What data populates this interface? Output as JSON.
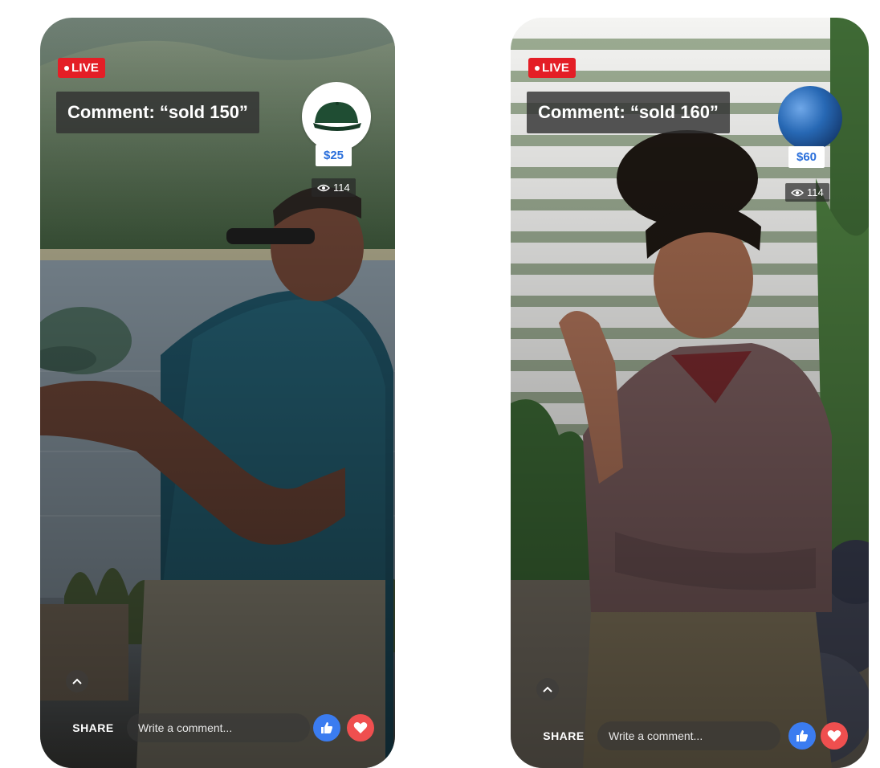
{
  "streams": [
    {
      "live_label": "LIVE",
      "comment_prompt": "Comment: “sold 150”",
      "product": {
        "name": "green cap",
        "price": "$25"
      },
      "viewer_count": "114",
      "share_label": "SHARE",
      "comment_placeholder": "Write a comment..."
    },
    {
      "live_label": "LIVE",
      "comment_prompt": "Comment: “sold 160”",
      "product": {
        "name": "blue exercise ball",
        "price": "$60"
      },
      "viewer_count": "114",
      "share_label": "SHARE",
      "comment_placeholder": "Write a comment..."
    }
  ],
  "colors": {
    "live_red": "#e41e26",
    "price_blue": "#2a6fdb",
    "like_blue": "#3b7cf0",
    "love_red": "#ef4f4f"
  }
}
